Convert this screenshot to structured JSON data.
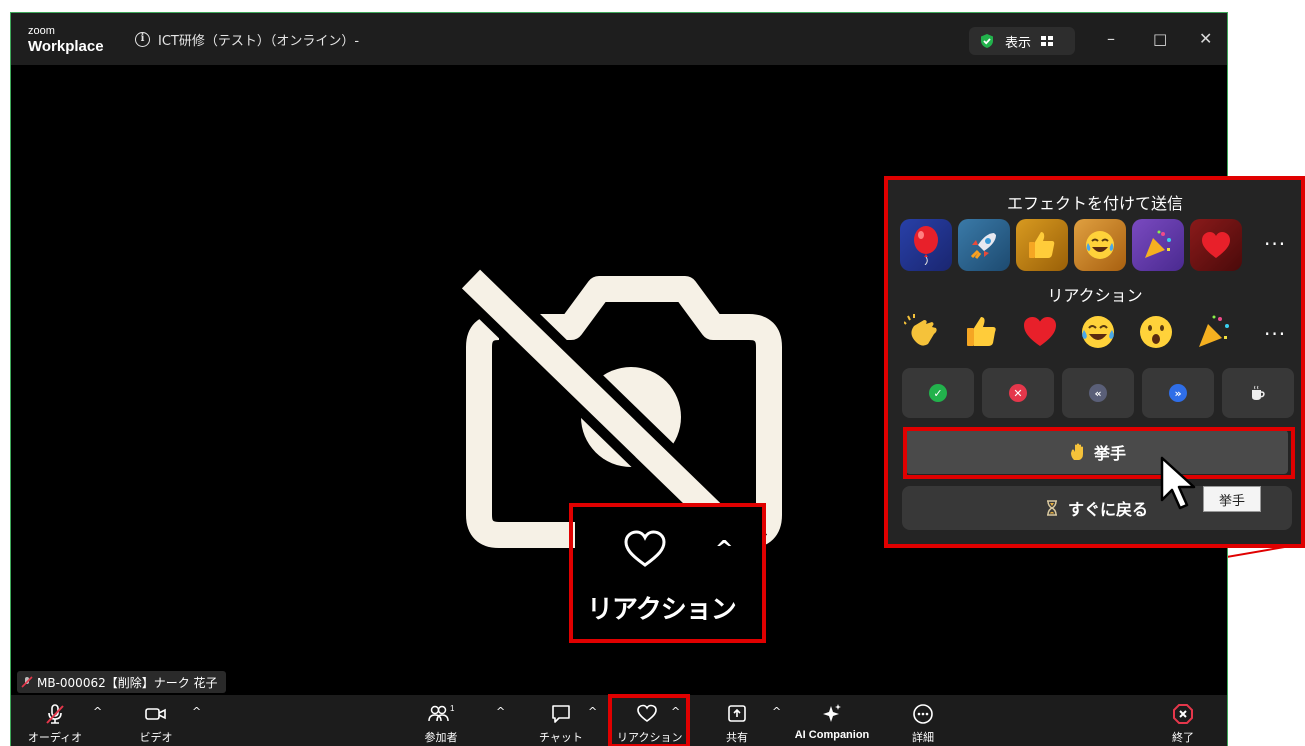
{
  "window": {
    "logo_top": "zoom",
    "logo_bottom": "Workplace",
    "title": "ICT研修（テスト）（オンライン）-",
    "view_button": "表示",
    "minimize": "–",
    "maximize": "□",
    "close": "✕"
  },
  "participant": {
    "name": "MB-000062【削除】ナーク 花子"
  },
  "toolbar": {
    "audio": "オーディオ",
    "video": "ビデオ",
    "participants": "参加者",
    "participants_count": "1",
    "chat": "チャット",
    "reactions": "リアクション",
    "share": "共有",
    "ai_companion": "AI Companion",
    "more": "詳細",
    "end": "終了"
  },
  "zoom_callout": {
    "label": "リアクション"
  },
  "popup": {
    "effects_heading": "エフェクトを付けて送信",
    "reactions_heading": "リアクション",
    "more": "···",
    "raise_hand": "挙手",
    "be_right_back": "すぐに戻る",
    "tooltip": "挙手"
  },
  "colors": {
    "highlight": "#e00000",
    "window_border": "#3fa85a",
    "yes": "#22b24c",
    "no": "#e5374b",
    "slower": "#5a5f78",
    "faster": "#2f6ee8"
  }
}
